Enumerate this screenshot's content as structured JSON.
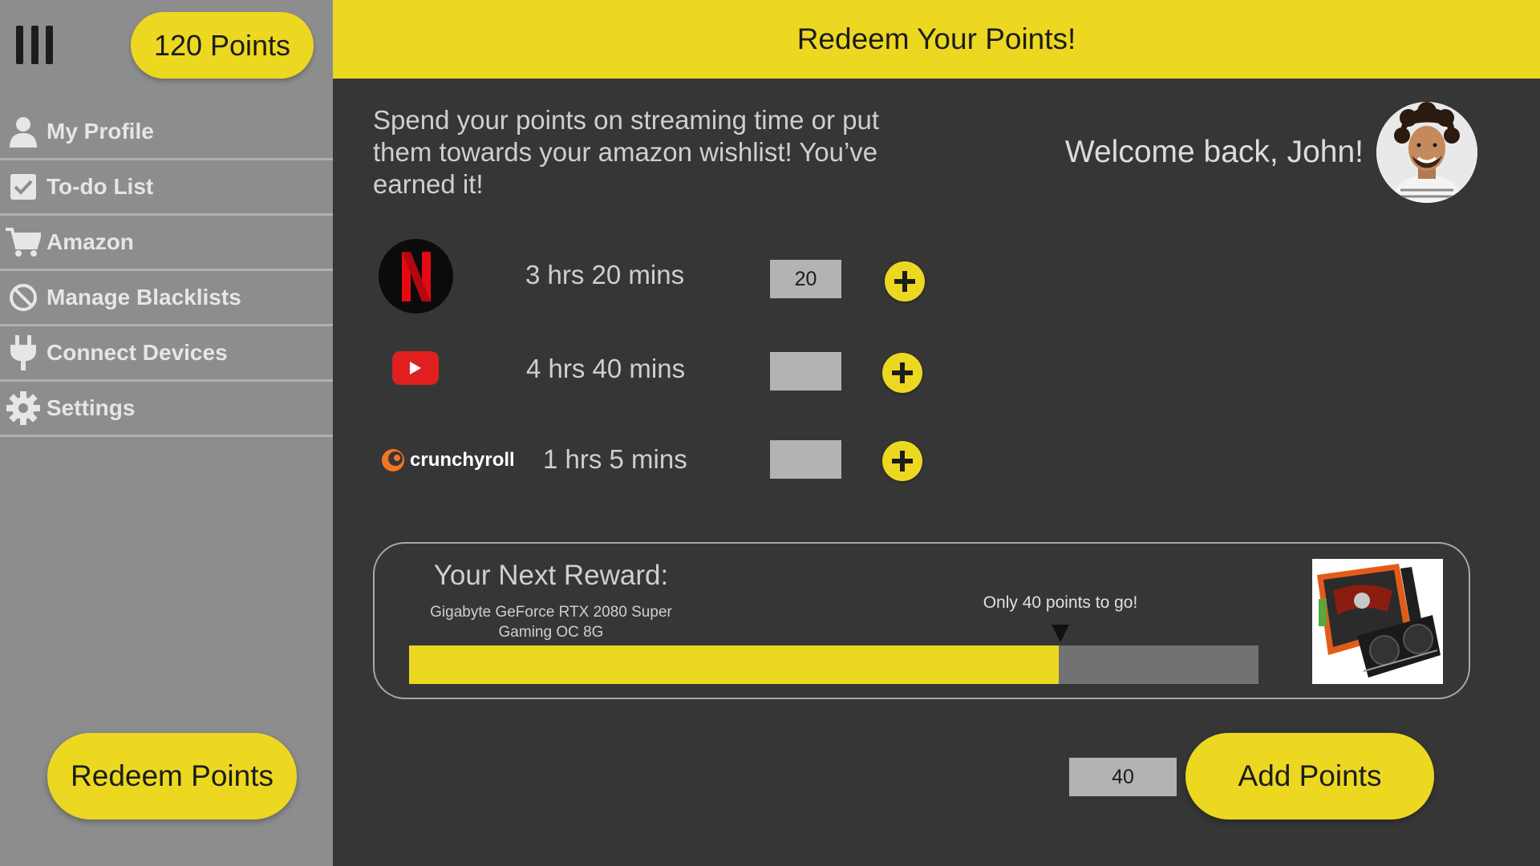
{
  "colors": {
    "accent": "#ecd821",
    "sidebar": "#8d8d8d",
    "background": "#363636",
    "progress_track": "#727272"
  },
  "sidebar": {
    "menu_icon": "hamburger-menu-icon",
    "points_badge": "120 Points",
    "items": [
      {
        "label": "My Profile",
        "icon": "user-icon"
      },
      {
        "label": "To-do List",
        "icon": "checkbox-icon"
      },
      {
        "label": "Amazon",
        "icon": "cart-icon"
      },
      {
        "label": "Manage Blacklists",
        "icon": "block-icon"
      },
      {
        "label": "Connect Devices",
        "icon": "plug-icon"
      },
      {
        "label": "Settings",
        "icon": "gear-icon"
      }
    ],
    "redeem_button": "Redeem Points"
  },
  "header": {
    "title": "Redeem Your Points!"
  },
  "main": {
    "intro": "Spend your points on streaming time or put them towards your amazon wishlist! You’ve earned it!",
    "welcome": "Welcome back, John!",
    "services": [
      {
        "name": "netflix",
        "logo_text": "N",
        "time": "3 hrs 20 mins",
        "value": "20"
      },
      {
        "name": "youtube",
        "time": "4 hrs 40 mins",
        "value": ""
      },
      {
        "name": "crunchyroll",
        "logo_text": "crunchyroll",
        "time": "1 hrs 5 mins",
        "value": ""
      }
    ],
    "reward": {
      "title": "Your Next Reward:",
      "product": "Gigabyte GeForce RTX 2080 Super Gaming OC 8G",
      "to_go": "Only 40 points to go!",
      "progress": 0.765
    },
    "add_points_value": "40",
    "add_points_button": "Add Points"
  }
}
